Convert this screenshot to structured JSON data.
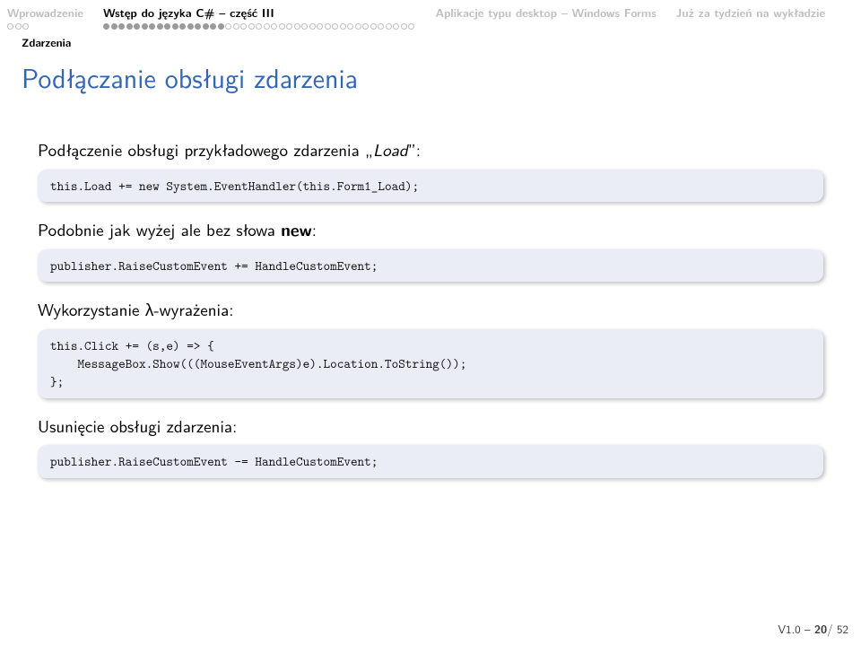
{
  "nav": {
    "sections": [
      {
        "title": "Wprowadzenie",
        "current": false,
        "dotsTotal": 3,
        "dotsFilled": 0
      },
      {
        "title": "Wstęp do języka C# – część III",
        "current": true,
        "dotsTotal": 41,
        "dotsFilled": 16
      },
      {
        "title": "Aplikacje typu desktop – Windows Forms",
        "current": false,
        "dotsTotal": 0,
        "dotsFilled": 0
      },
      {
        "title": "Już za tydzień na wykładzie",
        "current": false,
        "dotsTotal": 0,
        "dotsFilled": 0
      }
    ],
    "subsection": "Zdarzenia"
  },
  "title": "Podłączanie obsługi zdarzenia",
  "body": {
    "p1_pre": "Podłączenie obsługi przykładowego zdarzenia „",
    "p1_em": "Load",
    "p1_post": "”:",
    "code1": "this.Load += new System.EventHandler(this.Form1_Load);",
    "p2_pre": "Podobnie jak wyżej ale bez słowa ",
    "p2_bold": "new",
    "p2_post": ":",
    "code2": "publisher.RaiseCustomEvent += HandleCustomEvent;",
    "p3": "Wykorzystanie λ-wyrażenia:",
    "code3": "this.Click += (s,e) => {\n    MessageBox.Show(((MouseEventArgs)e).Location.ToString());\n};",
    "p4": "Usunięcie obsługi zdarzenia:",
    "code4": "publisher.RaiseCustomEvent -= HandleCustomEvent;"
  },
  "footer": {
    "version": "V1.0",
    "sep": " – ",
    "current": "20",
    "total": "/ 52"
  }
}
